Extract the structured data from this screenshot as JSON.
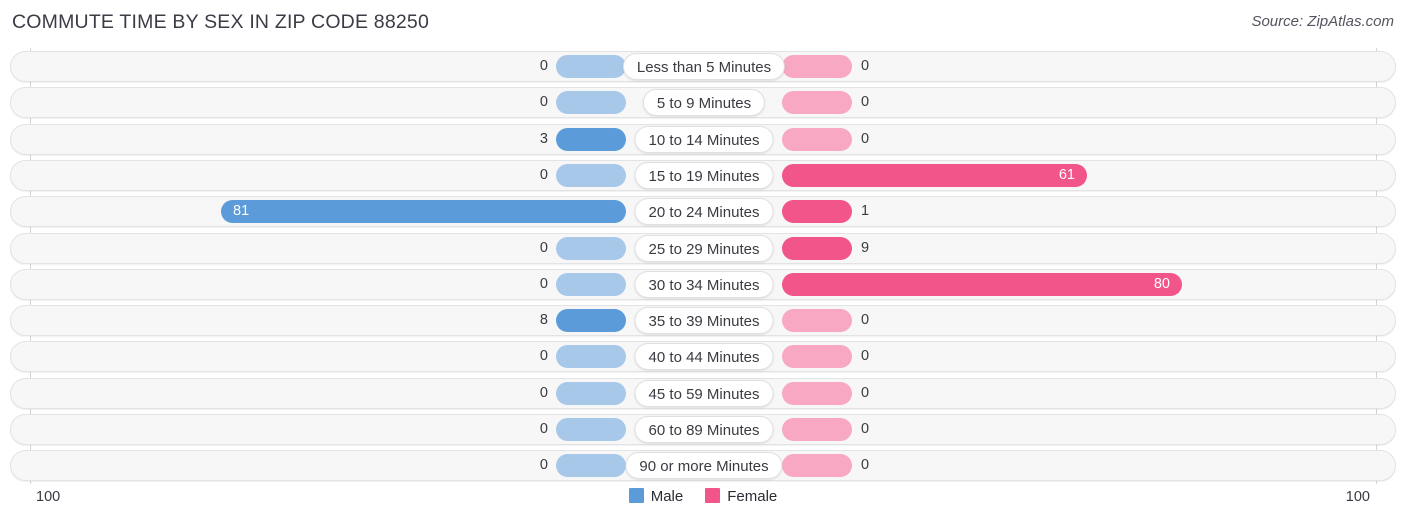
{
  "header": {
    "title": "COMMUTE TIME BY SEX IN ZIP CODE 88250",
    "source": "Source: ZipAtlas.com"
  },
  "axis": {
    "left_end": "100",
    "right_end": "100",
    "max": 100
  },
  "legend": {
    "items": [
      {
        "label": "Male",
        "color": "#5b9bd9"
      },
      {
        "label": "Female",
        "color": "#f2558a"
      }
    ]
  },
  "colors": {
    "male_light": "#a8c8ea",
    "male_dark": "#5b9bd9",
    "female_light": "#f9a8c4",
    "female_dark": "#f2558a",
    "track": "#f7f7f7"
  },
  "chart_data": {
    "type": "bar",
    "title": "COMMUTE TIME BY SEX IN ZIP CODE 88250",
    "subtitle": "",
    "xlabel": "",
    "ylabel": "",
    "orientation": "horizontal-diverging",
    "grid": false,
    "legend_position": "bottom-center",
    "axis_max": 100,
    "xlim": [
      100,
      100
    ],
    "categories": [
      "Less than 5 Minutes",
      "5 to 9 Minutes",
      "10 to 14 Minutes",
      "15 to 19 Minutes",
      "20 to 24 Minutes",
      "25 to 29 Minutes",
      "30 to 34 Minutes",
      "35 to 39 Minutes",
      "40 to 44 Minutes",
      "45 to 59 Minutes",
      "60 to 89 Minutes",
      "90 or more Minutes"
    ],
    "series": [
      {
        "name": "Male",
        "color": "#5b9bd9",
        "values": [
          0,
          0,
          3,
          0,
          81,
          0,
          0,
          8,
          0,
          0,
          0,
          0
        ]
      },
      {
        "name": "Female",
        "color": "#f2558a",
        "values": [
          0,
          0,
          0,
          61,
          1,
          9,
          80,
          0,
          0,
          0,
          0,
          0
        ]
      }
    ]
  }
}
